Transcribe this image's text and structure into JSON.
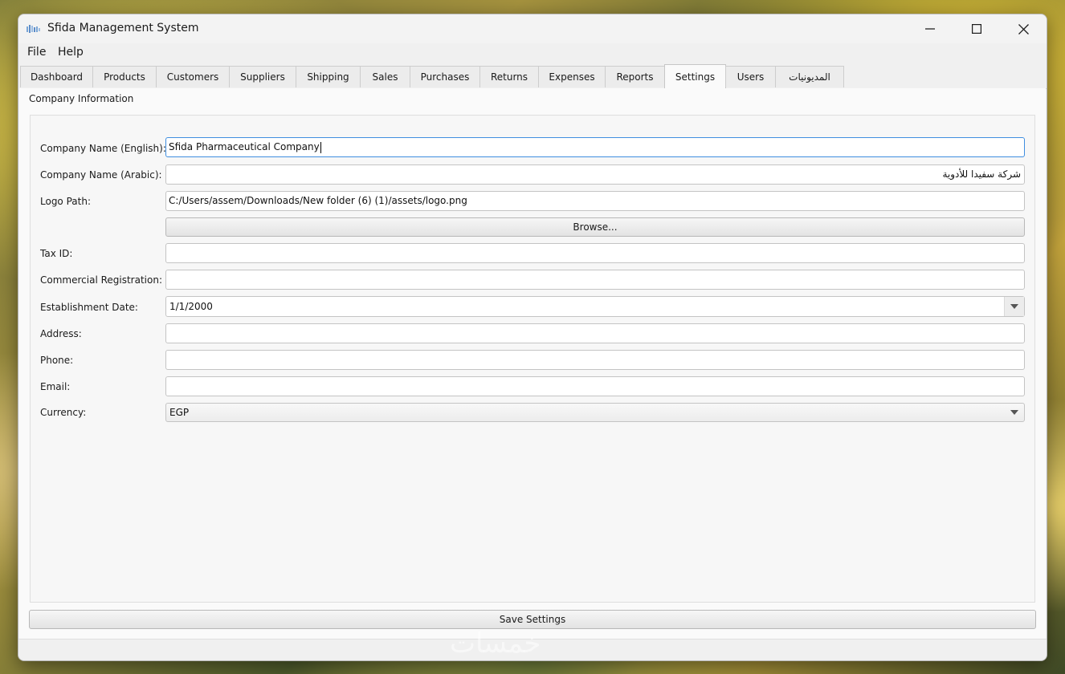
{
  "window": {
    "title": "Sfida Management System"
  },
  "menu": {
    "file": "File",
    "help": "Help"
  },
  "tabs": [
    {
      "label": "Dashboard"
    },
    {
      "label": "Products"
    },
    {
      "label": "Customers"
    },
    {
      "label": "Suppliers"
    },
    {
      "label": "Shipping"
    },
    {
      "label": "Sales"
    },
    {
      "label": "Purchases"
    },
    {
      "label": "Returns"
    },
    {
      "label": "Expenses"
    },
    {
      "label": "Reports"
    },
    {
      "label": "Settings",
      "active": true
    },
    {
      "label": "Users"
    },
    {
      "label": "المديونيات"
    }
  ],
  "settings": {
    "group_title": "Company Information",
    "fields": {
      "company_name_en": {
        "label": "Company Name (English):",
        "value": "Sfida Pharmaceutical Company"
      },
      "company_name_ar": {
        "label": "Company Name (Arabic):",
        "value": "شركة سفيدا للأدوية"
      },
      "logo_path": {
        "label": "Logo Path:",
        "value": "C:/Users/assem/Downloads/New folder (6) (1)/assets/logo.png"
      },
      "tax_id": {
        "label": "Tax ID:",
        "value": ""
      },
      "commercial_registration": {
        "label": "Commercial Registration:",
        "value": ""
      },
      "establishment_date": {
        "label": "Establishment Date:",
        "value": "1/1/2000"
      },
      "address": {
        "label": "Address:",
        "value": ""
      },
      "phone": {
        "label": "Phone:",
        "value": ""
      },
      "email": {
        "label": "Email:",
        "value": ""
      },
      "currency": {
        "label": "Currency:",
        "value": "EGP"
      }
    },
    "browse_label": "Browse...",
    "save_label": "Save Settings"
  },
  "watermark": "خمسات",
  "icons": {
    "app": "app-logo-icon",
    "minimize": "minimize-icon",
    "maximize": "maximize-icon",
    "close": "close-icon",
    "dropdown": "chevron-down-icon"
  },
  "colors": {
    "focus_border": "#3f8ee0",
    "window_bg": "#f0f0f0",
    "content_bg": "#fafafa"
  }
}
